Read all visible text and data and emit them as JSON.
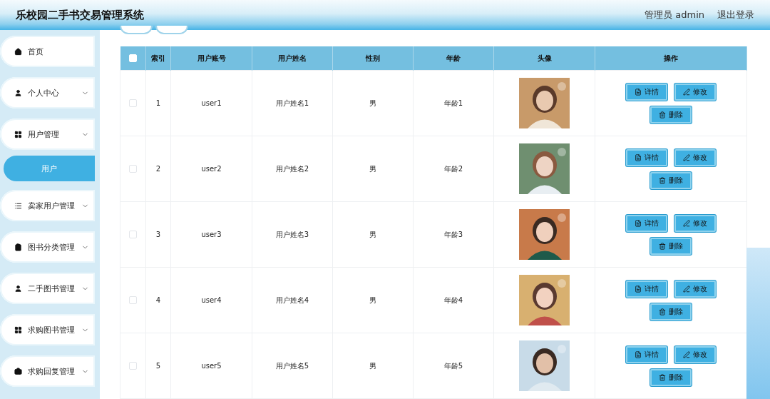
{
  "header": {
    "title": "乐校园二手书交易管理系统",
    "user": "管理员 admin",
    "logout": "退出登录"
  },
  "sidebar": {
    "items": [
      {
        "kind": "menu",
        "label": "首页",
        "expandable": false,
        "selected": false
      },
      {
        "kind": "menu",
        "label": "个人中心",
        "expandable": true,
        "selected": false
      },
      {
        "kind": "menu",
        "label": "用户管理",
        "expandable": true,
        "selected": false
      },
      {
        "kind": "submenu",
        "label": "用户",
        "selected": true
      },
      {
        "kind": "menu",
        "label": "卖家用户管理",
        "expandable": true,
        "selected": false
      },
      {
        "kind": "menu",
        "label": "图书分类管理",
        "expandable": true,
        "selected": false
      },
      {
        "kind": "menu",
        "label": "二手图书管理",
        "expandable": true,
        "selected": false
      },
      {
        "kind": "menu",
        "label": "求购图书管理",
        "expandable": true,
        "selected": false
      },
      {
        "kind": "menu",
        "label": "求购回复管理",
        "expandable": true,
        "selected": false
      }
    ]
  },
  "table": {
    "select_all": {
      "checked": false
    },
    "columns": [
      "索引",
      "用户账号",
      "用户姓名",
      "性别",
      "年龄",
      "头像",
      "操作"
    ],
    "rows": [
      {
        "checked": false,
        "index": "1",
        "account": "user1",
        "name": "用户姓名1",
        "gender": "男",
        "age": "年龄1",
        "actions": [
          "详情",
          "修改",
          "删除"
        ]
      },
      {
        "checked": false,
        "index": "2",
        "account": "user2",
        "name": "用户姓名2",
        "gender": "男",
        "age": "年龄2",
        "actions": [
          "详情",
          "修改",
          "删除"
        ]
      },
      {
        "checked": false,
        "index": "3",
        "account": "user3",
        "name": "用户姓名3",
        "gender": "男",
        "age": "年龄3",
        "actions": [
          "详情",
          "修改",
          "删除"
        ]
      },
      {
        "checked": false,
        "index": "4",
        "account": "user4",
        "name": "用户姓名4",
        "gender": "男",
        "age": "年龄4",
        "actions": [
          "详情",
          "修改",
          "删除"
        ]
      },
      {
        "checked": false,
        "index": "5",
        "account": "user5",
        "name": "用户姓名5",
        "gender": "男",
        "age": "年龄5",
        "actions": [
          "详情",
          "修改",
          "删除"
        ]
      }
    ]
  }
}
